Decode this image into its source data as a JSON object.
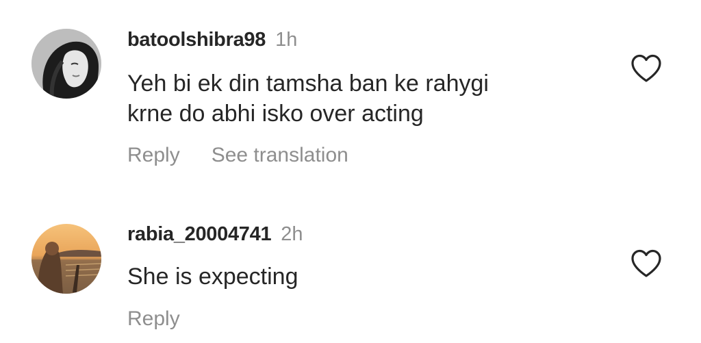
{
  "comments": [
    {
      "username": "batoolshibra98",
      "time": "1h",
      "text_lines": [
        "Yeh bi ek din tamsha ban ke rahygi",
        "krne do abhi isko over acting"
      ],
      "actions": {
        "reply": "Reply",
        "translate": "See translation"
      },
      "like_icon": "heart-outline-icon",
      "avatar_style": "grayscale-portrait"
    },
    {
      "username": "rabia_20004741",
      "time": "2h",
      "text_lines": [
        "She is expecting"
      ],
      "actions": {
        "reply": "Reply"
      },
      "like_icon": "heart-outline-icon",
      "avatar_style": "sunset-beach"
    }
  ],
  "colors": {
    "text": "#262626",
    "muted": "#8e8e8e",
    "background": "#ffffff"
  }
}
